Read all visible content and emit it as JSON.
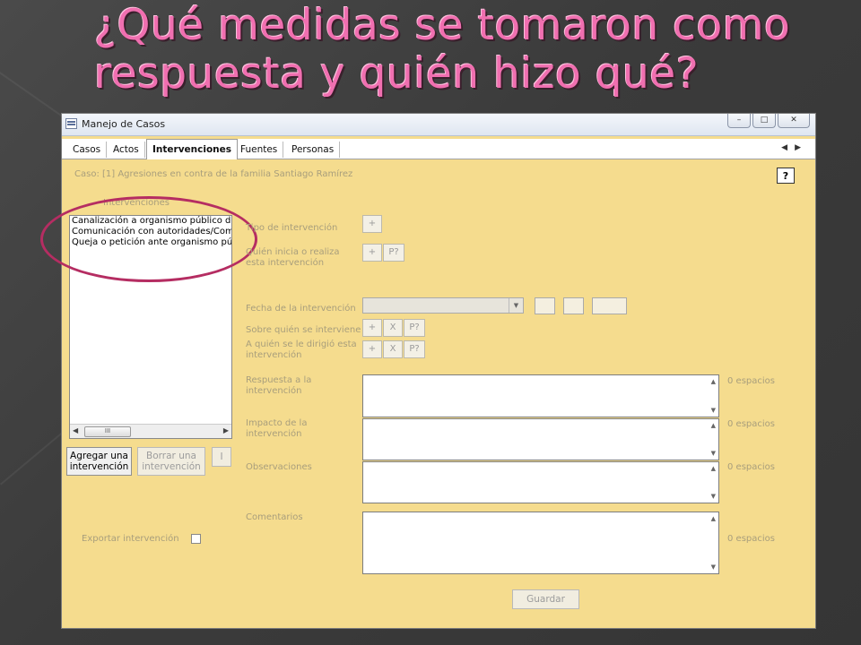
{
  "slide": {
    "title_line1": "¿Qué medidas se tomaron como",
    "title_line2": "respuesta y quién hizo qué?"
  },
  "window": {
    "title": "Manejo de Casos",
    "buttons": {
      "minimize": "–",
      "maximize": "□",
      "close": "✕"
    }
  },
  "tabs": [
    {
      "label": "Casos",
      "active": false
    },
    {
      "label": "Actos",
      "active": false
    },
    {
      "label": "Intervenciones",
      "active": true
    },
    {
      "label": "Fuentes",
      "active": false
    },
    {
      "label": "Personas",
      "active": false
    }
  ],
  "tab_nav": {
    "prev": "◀",
    "next": "▶"
  },
  "case_label": "Caso: [1] Agresiones en contra de la familia Santiago Ramírez",
  "help_button": "?",
  "interventions": {
    "group_label": "Intervenciones",
    "items": [
      "Canalización a organismo público de d",
      "Comunicación con autoridades/Comisi",
      "Queja o petición ante organismo públ"
    ],
    "scroll_left": "◀",
    "scroll_right": "▶",
    "scroll_thumb": "III"
  },
  "buttons": {
    "add": "Agregar una intervención",
    "delete": "Borrar una intervención",
    "info": "I",
    "save": "Guardar"
  },
  "form": {
    "tipo": "Tipo de intervención",
    "quien_inicia": "Quién inicia o realiza esta intervención",
    "fecha": "Fecha de la intervención",
    "sobre_quien": "Sobre quién se interviene",
    "a_quien": "A quién se le dirigió esta intervención",
    "respuesta": "Respuesta a la intervención",
    "impacto": "Impacto de la intervención",
    "observaciones": "Observaciones",
    "comentarios": "Comentarios",
    "exportar": "Exportar intervención"
  },
  "mini_buttons": {
    "plus": "+",
    "x": "X",
    "p": "P?"
  },
  "select_arrow": "▼",
  "textarea_arrows": {
    "up": "▲",
    "down": "▼"
  },
  "counts": {
    "respuesta": "0 espacios",
    "impacto": "0 espacios",
    "observaciones": "0 espacios",
    "comentarios": "0 espacios"
  },
  "colors": {
    "form_bg": "#f5dc8e",
    "title_pink": "#f06fb0",
    "highlight": "#b52d62"
  }
}
